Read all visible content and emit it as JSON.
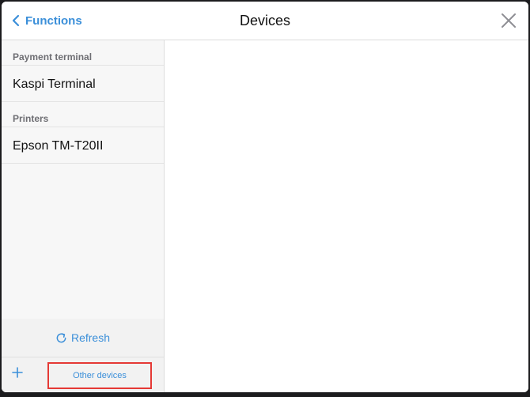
{
  "header": {
    "back_label": "Functions",
    "title": "Devices"
  },
  "sidebar": {
    "sections": [
      {
        "title": "Payment terminal",
        "items": [
          "Kaspi Terminal"
        ]
      },
      {
        "title": "Printers",
        "items": [
          "Epson TM-T20II"
        ]
      }
    ],
    "refresh_label": "Refresh",
    "other_devices_label": "Other devices"
  },
  "colors": {
    "accent": "#3b8fd9",
    "highlight_border": "#e53935"
  },
  "icons": {
    "back": "chevron-left-icon",
    "close": "close-icon",
    "refresh": "refresh-icon",
    "add": "plus-icon"
  }
}
